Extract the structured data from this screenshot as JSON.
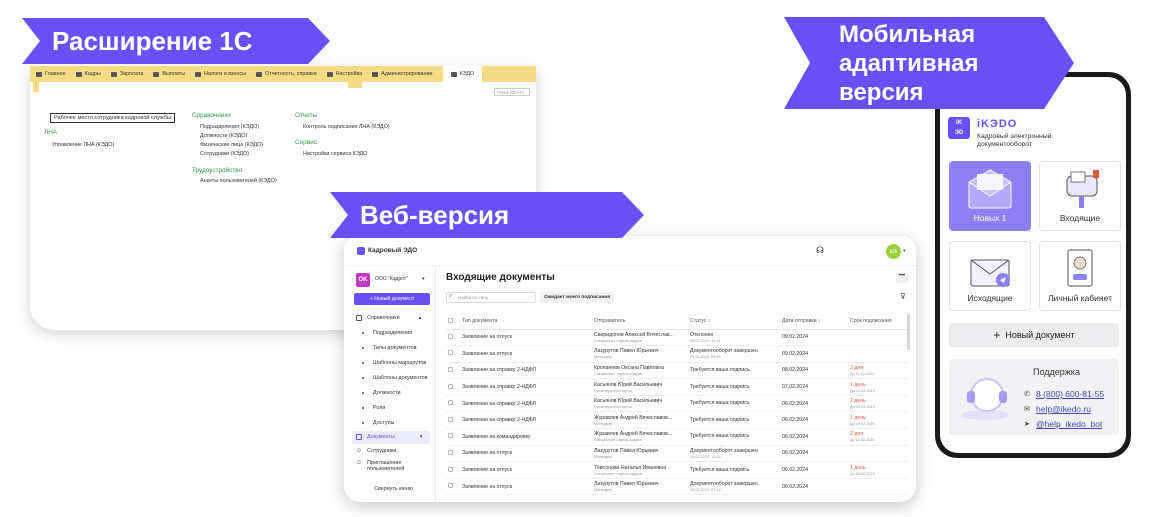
{
  "banners": {
    "onec": "Расширение 1С",
    "web": "Веб-версия",
    "mobile_lines": [
      "Мобильная",
      "адаптивная",
      "версия"
    ]
  },
  "onec": {
    "menu": [
      "Главное",
      "Кадры",
      "Зарплата",
      "Выплаты",
      "Налоги и взносы",
      "Отчетность, справки",
      "Настройка",
      "Администрирование",
      "КЭДО"
    ],
    "search_placeholder": "Поиск (Ctrl+F)",
    "workplace": "Рабочее место сотрудника кадровой службы",
    "lna_title": "ЛНА",
    "lna_item": "Управление ЛНА (КЭДО)",
    "refs_title": "Справочники",
    "refs": [
      "Подразделения (КЭДО)",
      "Должности (КЭДО)",
      "Физические лица (КЭДО)",
      "Сотрудники (КЭДО)"
    ],
    "employment_title": "Трудоустройство",
    "employment_item": "Анкеты пользователей (КЭДО)",
    "reports_title": "Отчеты",
    "reports_item": "Контроль подписания ЛНА (КЭДО)",
    "service_title": "Сервис",
    "service_item": "Настройки сервиса КЭДО"
  },
  "web": {
    "app_title": "Кадровый ЭДО",
    "avatar": "ША",
    "org_logo": "OK",
    "org_name": "ООО \"Кадрот\"",
    "new_doc": "+ Новый документ",
    "sidebar": {
      "refs": "Справочники",
      "items": [
        "Подразделения",
        "Типы документов",
        "Шаблоны маршрутов",
        "Шаблоны документов",
        "Должности",
        "Роли",
        "Доступы"
      ],
      "documents": "Документы",
      "employees": "Сотрудники",
      "invitations": "Приглашение пользователей",
      "collapse": "Свернуть меню"
    },
    "page_title": "Входящие документы",
    "search_placeholder": "Найти по типу",
    "filter_chip": "Ожидает моего подписания",
    "columns": [
      "Тип документа",
      "Отправитель",
      "Статус",
      "Дата отправки",
      "Срок подписания"
    ],
    "rows": [
      {
        "type": "Заявление на отпуск",
        "sender": "Свиридонов Алексей Вячеслав...",
        "sender_role": "Специалист отдела кадров",
        "status": "Отклонен",
        "status_date": "09.02.2024, 11:19",
        "date": "09.02.2024",
        "deadline": "",
        "deadline_date": ""
      },
      {
        "type": "Заявление на отпуск",
        "sender": "Лазурутов Павел Юрьевич",
        "sender_role": "Менеджер",
        "status": "Документооборот завершен",
        "status_date": "09.02.2024, 08:16",
        "date": "09.02.2024",
        "deadline": "",
        "deadline_date": ""
      },
      {
        "type": "Заявление на справку 2-НДФЛ",
        "sender": "Кропанева Оксана Павловна",
        "sender_role": "Специалист отдела кадров",
        "status": "Требуется ваша подпись",
        "status_date": "",
        "date": "08.02.2024",
        "deadline": "2 дня",
        "deadline_date": "До 11.02.2024"
      },
      {
        "type": "Заявление на справку 2-НДФЛ",
        "sender": "Касьянов Юрий Васильевич",
        "sender_role": "Руководитель отдела",
        "status": "Требуется ваша подпись",
        "status_date": "",
        "date": "07.02.2024",
        "deadline": "1 день",
        "deadline_date": "До 10.02.2024"
      },
      {
        "type": "Заявление на справку 2-НДФЛ",
        "sender": "Касьянов Юрий Васильевич",
        "sender_role": "Руководитель отдела",
        "status": "Требуется ваша подпись",
        "status_date": "",
        "date": "06.02.2024",
        "deadline": "1 день",
        "deadline_date": "До 09.02.2024"
      },
      {
        "type": "Заявление на справку 2-НДФЛ",
        "sender": "Журавлев Андрей Вячеславов...",
        "sender_role": "Менеджер",
        "status": "Требуется ваша подпись",
        "status_date": "",
        "date": "06.02.2024",
        "deadline": "1 день",
        "deadline_date": "До 09.02.2024"
      },
      {
        "type": "Заявление на командировку",
        "sender": "Журавлев Андрей Вячеславов...",
        "sender_role": "Специалист отдела кадров",
        "status": "Требуется ваша подпись",
        "status_date": "",
        "date": "06.02.2024",
        "deadline": "2 дня",
        "deadline_date": "До 11.02.2024"
      },
      {
        "type": "Заявление на отпуск",
        "sender": "Лазурутов Павел Юрьевич",
        "sender_role": "Менеджер",
        "status": "Документооборот завершен",
        "status_date": "06.02.2024, 13:32",
        "date": "06.02.2024",
        "deadline": "",
        "deadline_date": ""
      },
      {
        "type": "Заявление на отпуск",
        "sender": "Тоисонова Наталья Ивановна",
        "sender_role": "Специалист отдела кадров",
        "status": "Требуется ваша подпись",
        "status_date": "",
        "date": "06.02.2024",
        "deadline": "1 день",
        "deadline_date": "До 09.02.2024"
      },
      {
        "type": "Заявление на отпуск",
        "sender": "Лазурутов Павел Юрьевич",
        "sender_role": "Менеджер",
        "status": "Документооборот завершен",
        "status_date": "06.02.2024, 07:14",
        "date": "06.02.2024",
        "deadline": "",
        "deadline_date": ""
      }
    ]
  },
  "mobile": {
    "brand": "iKЭDO",
    "brand_sub": "Кадровый электронный документооборот",
    "tiles": [
      "Новых 1",
      "Входящие",
      "Исходящие",
      "Личный кабинет"
    ],
    "new_doc": "Новый документ",
    "support_title": "Поддержка",
    "phone": "8 (800) 600-81-55",
    "email": "help@ikedo.ru",
    "telegram": "@help_ikedo_bot"
  },
  "colors": {
    "accent": "#6b4ff6",
    "tile_active": "#8e7ff7",
    "onec_toolbar": "#f5dc84",
    "onec_green": "#2e9d3e",
    "late": "#e05a3a"
  }
}
